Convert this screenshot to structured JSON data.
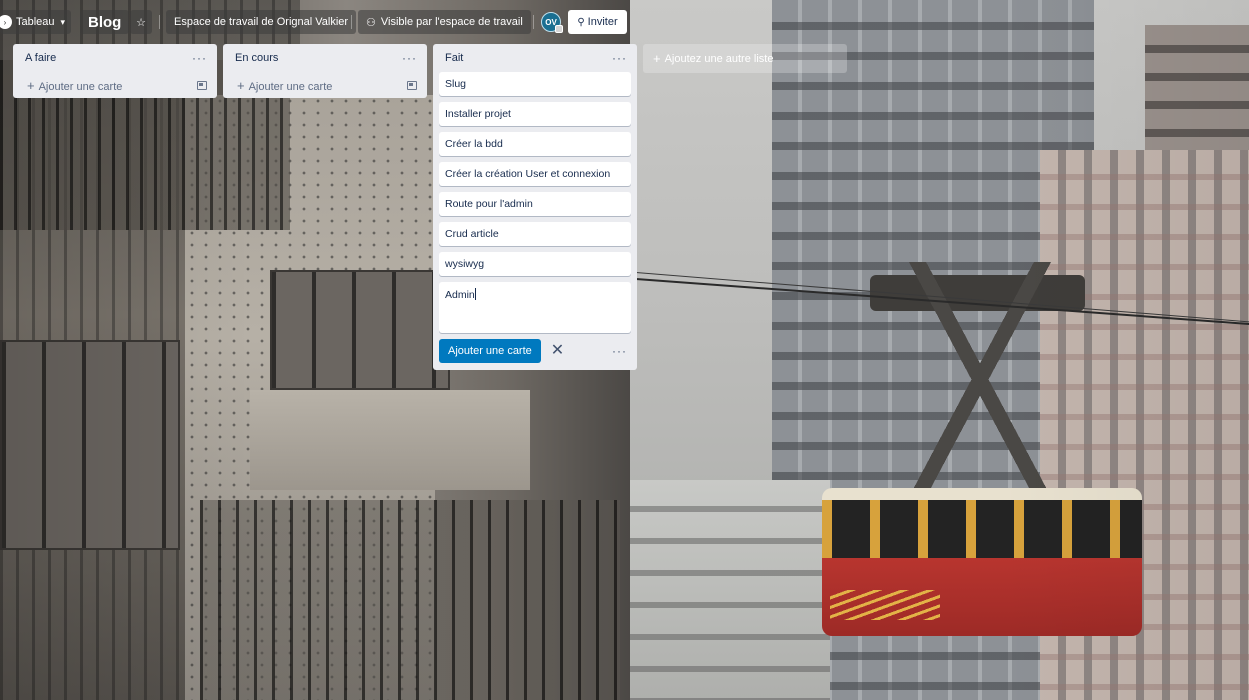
{
  "header": {
    "view_label": "Tableau",
    "board_title": "Blog",
    "workspace_label": "Espace de travail de Orignal Valkier",
    "visibility_label": "Visible par l'espace de travail",
    "avatar_initials": "OV",
    "invite_label": "Inviter"
  },
  "lists": [
    {
      "title": "A faire",
      "add_card_label": "Ajouter une carte",
      "cards": []
    },
    {
      "title": "En cours",
      "add_card_label": "Ajouter une carte",
      "cards": []
    },
    {
      "title": "Fait",
      "cards": [
        "Slug",
        "Installer projet",
        "Créer la bdd",
        "Créer la création User et connexion",
        "Route pour l'admin",
        "Crud article",
        "wysiwyg"
      ],
      "composer_value": "Admin",
      "composer_submit_label": "Ajouter une carte"
    }
  ],
  "add_list_label": "Ajoutez une autre liste",
  "icons": {
    "list_menu": "ellipsis-icon",
    "add": "plus-icon",
    "template": "card-template-icon",
    "close": "close-icon",
    "star": "star-icon",
    "visibility": "people-icon",
    "invite": "user-add-icon"
  }
}
